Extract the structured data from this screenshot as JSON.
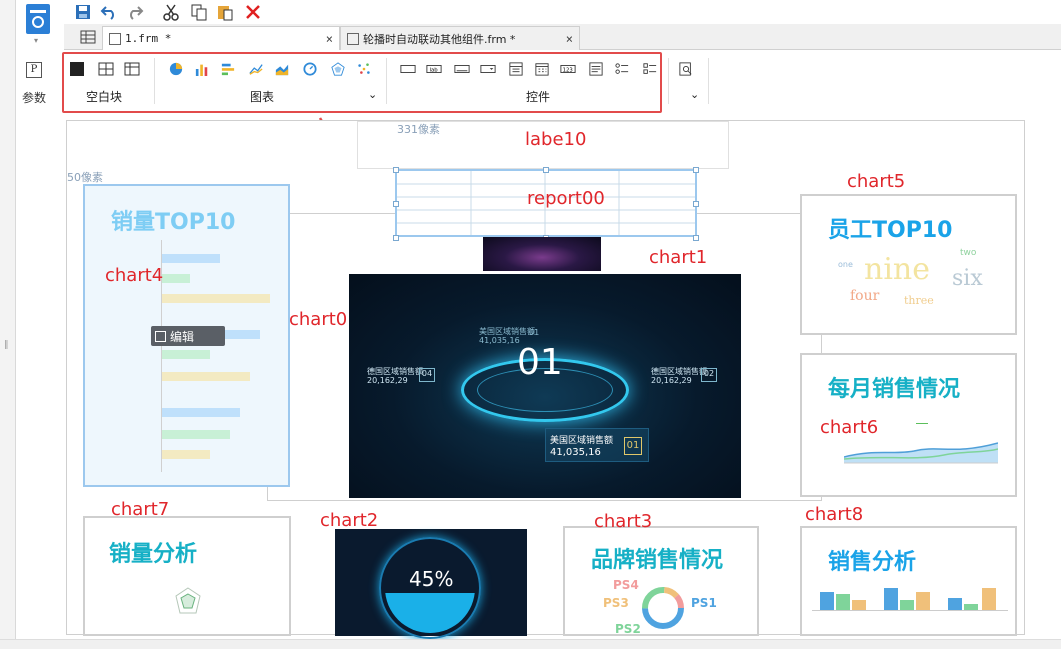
{
  "left_panel": {
    "param_label": "参数"
  },
  "tabs": [
    {
      "label": "1.frm *",
      "close": "×"
    },
    {
      "label": "轮播时自动联动其他组件.frm *",
      "close": "×"
    }
  ],
  "ribbon": {
    "groups": [
      {
        "label": "空白块"
      },
      {
        "label": "图表"
      },
      {
        "label": "控件"
      }
    ],
    "expand": "⌄"
  },
  "canvas": {
    "ruler_top": "331像素",
    "ruler_left": "50像素",
    "labels": {
      "label10": "labe10",
      "report00": "report00",
      "chart1": "chart1",
      "chart0": "chart0",
      "chart4": "chart4",
      "chart5": "chart5",
      "chart6": "chart6",
      "chart7": "chart7",
      "chart2": "chart2",
      "chart3": "chart3",
      "chart8": "chart8"
    },
    "widgets": {
      "top10": {
        "title": "销量TOP10",
        "edit": "编辑"
      },
      "staff": {
        "title": "员工TOP10",
        "words": [
          "one",
          "nine",
          "two",
          "six",
          "four",
          "three"
        ]
      },
      "monthly": {
        "title": "每月销售情况"
      },
      "sales_analysis": {
        "title": "销量分析"
      },
      "brand": {
        "title": "品牌销售情况",
        "legend": [
          "PS4",
          "PS3",
          "PS2",
          "PS1"
        ]
      },
      "sales2": {
        "title": "销售分析"
      },
      "gauge": {
        "value": "45%"
      },
      "dashboard": {
        "center": "01",
        "top_label": "美国区域销售额",
        "top_value": "41,035,16",
        "left_label": "德国区域销售额",
        "left_value": "20,162,29",
        "right_label": "德国区域销售额",
        "right_value": "20,162,29",
        "badge_left": "04",
        "badge_right": "02",
        "badge_top": "01",
        "bottom_label": "美国区域销售额",
        "bottom_value": "41,035,16",
        "bottom_badge": "01"
      }
    }
  },
  "colors": {
    "accent_red": "#e24b4b",
    "title_blue": "#1aa3e8",
    "title_teal": "#16b0c6"
  }
}
